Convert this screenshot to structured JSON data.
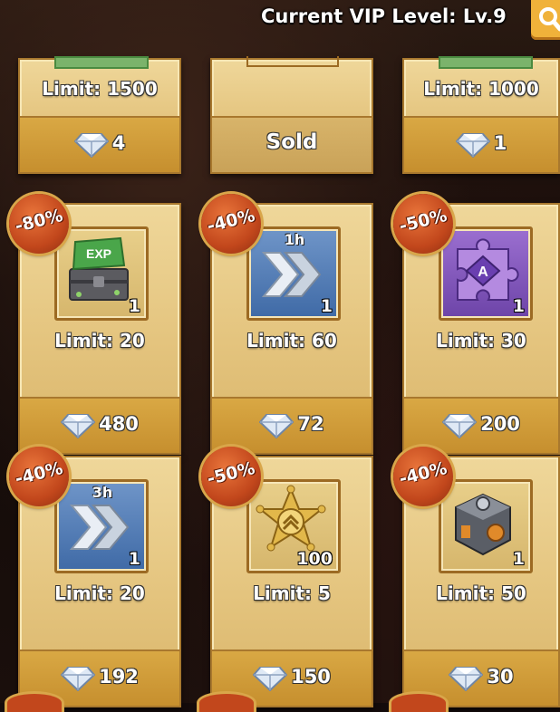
{
  "header": {
    "vip_label": "Current VIP Level: Lv.9"
  },
  "icons": {
    "search": "search-icon",
    "gem": "diamond-icon"
  },
  "colors": {
    "card_gold": "#e4c47e",
    "price_bar": "#c68f2e",
    "discount_badge": "#c2471c",
    "search_button": "#f0b23a"
  },
  "top_row": [
    {
      "limit": "Limit: 1500",
      "price": "4"
    },
    {
      "sold": "Sold"
    },
    {
      "limit": "Limit: 1000",
      "price": "1"
    }
  ],
  "items": [
    {
      "discount": "-80%",
      "icon": "exp-chest-icon",
      "qty": "1",
      "limit": "Limit: 20",
      "price": "480"
    },
    {
      "discount": "-40%",
      "icon": "speedup-1h-icon",
      "caption": "1h",
      "qty": "1",
      "limit": "Limit: 60",
      "price": "72"
    },
    {
      "discount": "-50%",
      "icon": "puzzle-a-icon",
      "qty": "1",
      "limit": "Limit: 30",
      "price": "200"
    },
    {
      "discount": "-40%",
      "icon": "speedup-3h-icon",
      "caption": "3h",
      "qty": "1",
      "limit": "Limit: 20",
      "price": "192"
    },
    {
      "discount": "-50%",
      "icon": "sheriff-badge-icon",
      "qty": "100",
      "limit": "Limit: 5",
      "price": "150"
    },
    {
      "discount": "-40%",
      "icon": "mech-cube-icon",
      "qty": "1",
      "limit": "Limit: 50",
      "price": "30"
    }
  ]
}
